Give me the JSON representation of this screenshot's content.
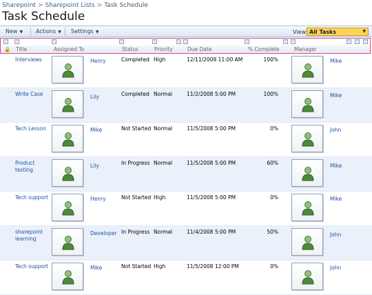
{
  "breadcrumb": {
    "items": [
      "Sharepoint",
      "Sharepoint Lists",
      "Task Schedule"
    ],
    "separator": ">"
  },
  "page_title": "Task Schedule",
  "toolbar": {
    "new_label": "New",
    "actions_label": "Actions",
    "settings_label": "Settings",
    "view_label": "View:",
    "view_value": "All Tasks"
  },
  "columns": [
    "Title",
    "Assigned To",
    "Status",
    "Priority",
    "Due Date",
    "% Complete",
    "Manager"
  ],
  "colors": {
    "accent": "#1f4fa3",
    "view_select": "#ffd35a",
    "highlight_border": "#d14a86",
    "alt_row": "#eaf1fa"
  },
  "tasks": [
    {
      "title": "Interviews",
      "assigned": "Henry",
      "status": "Completed",
      "priority": "High",
      "due": "12/11/2008 11:00 AM",
      "pct": "100%",
      "manager": "Mike"
    },
    {
      "title": "Write Case",
      "assigned": "Lily",
      "status": "Completed",
      "priority": "Normal",
      "due": "11/2/2008 5:00 PM",
      "pct": "100%",
      "manager": "Mike"
    },
    {
      "title": "Tech Lesson",
      "assigned": "Mike",
      "status": "Not Started",
      "priority": "Normal",
      "due": "11/5/2008 5:00 PM",
      "pct": "0%",
      "manager": "John"
    },
    {
      "title": "Product testing",
      "assigned": "Lily",
      "status": "In Progress",
      "priority": "Normal",
      "due": "11/5/2008 5:00 PM",
      "pct": "60%",
      "manager": "Mike"
    },
    {
      "title": "Tech support",
      "assigned": "Henry",
      "status": "Not Started",
      "priority": "High",
      "due": "11/5/2008 5:00 PM",
      "pct": "0%",
      "manager": "Mike"
    },
    {
      "title": "sharepoint learning",
      "assigned": "Developer",
      "status": "In Progress",
      "priority": "Normal",
      "due": "11/4/2008 5:00 PM",
      "pct": "50%",
      "manager": "John"
    },
    {
      "title": "Tech support",
      "assigned": "Mike",
      "status": "Not Started",
      "priority": "High",
      "due": "11/5/2008 12:00 PM",
      "pct": "0%",
      "manager": "John"
    }
  ]
}
